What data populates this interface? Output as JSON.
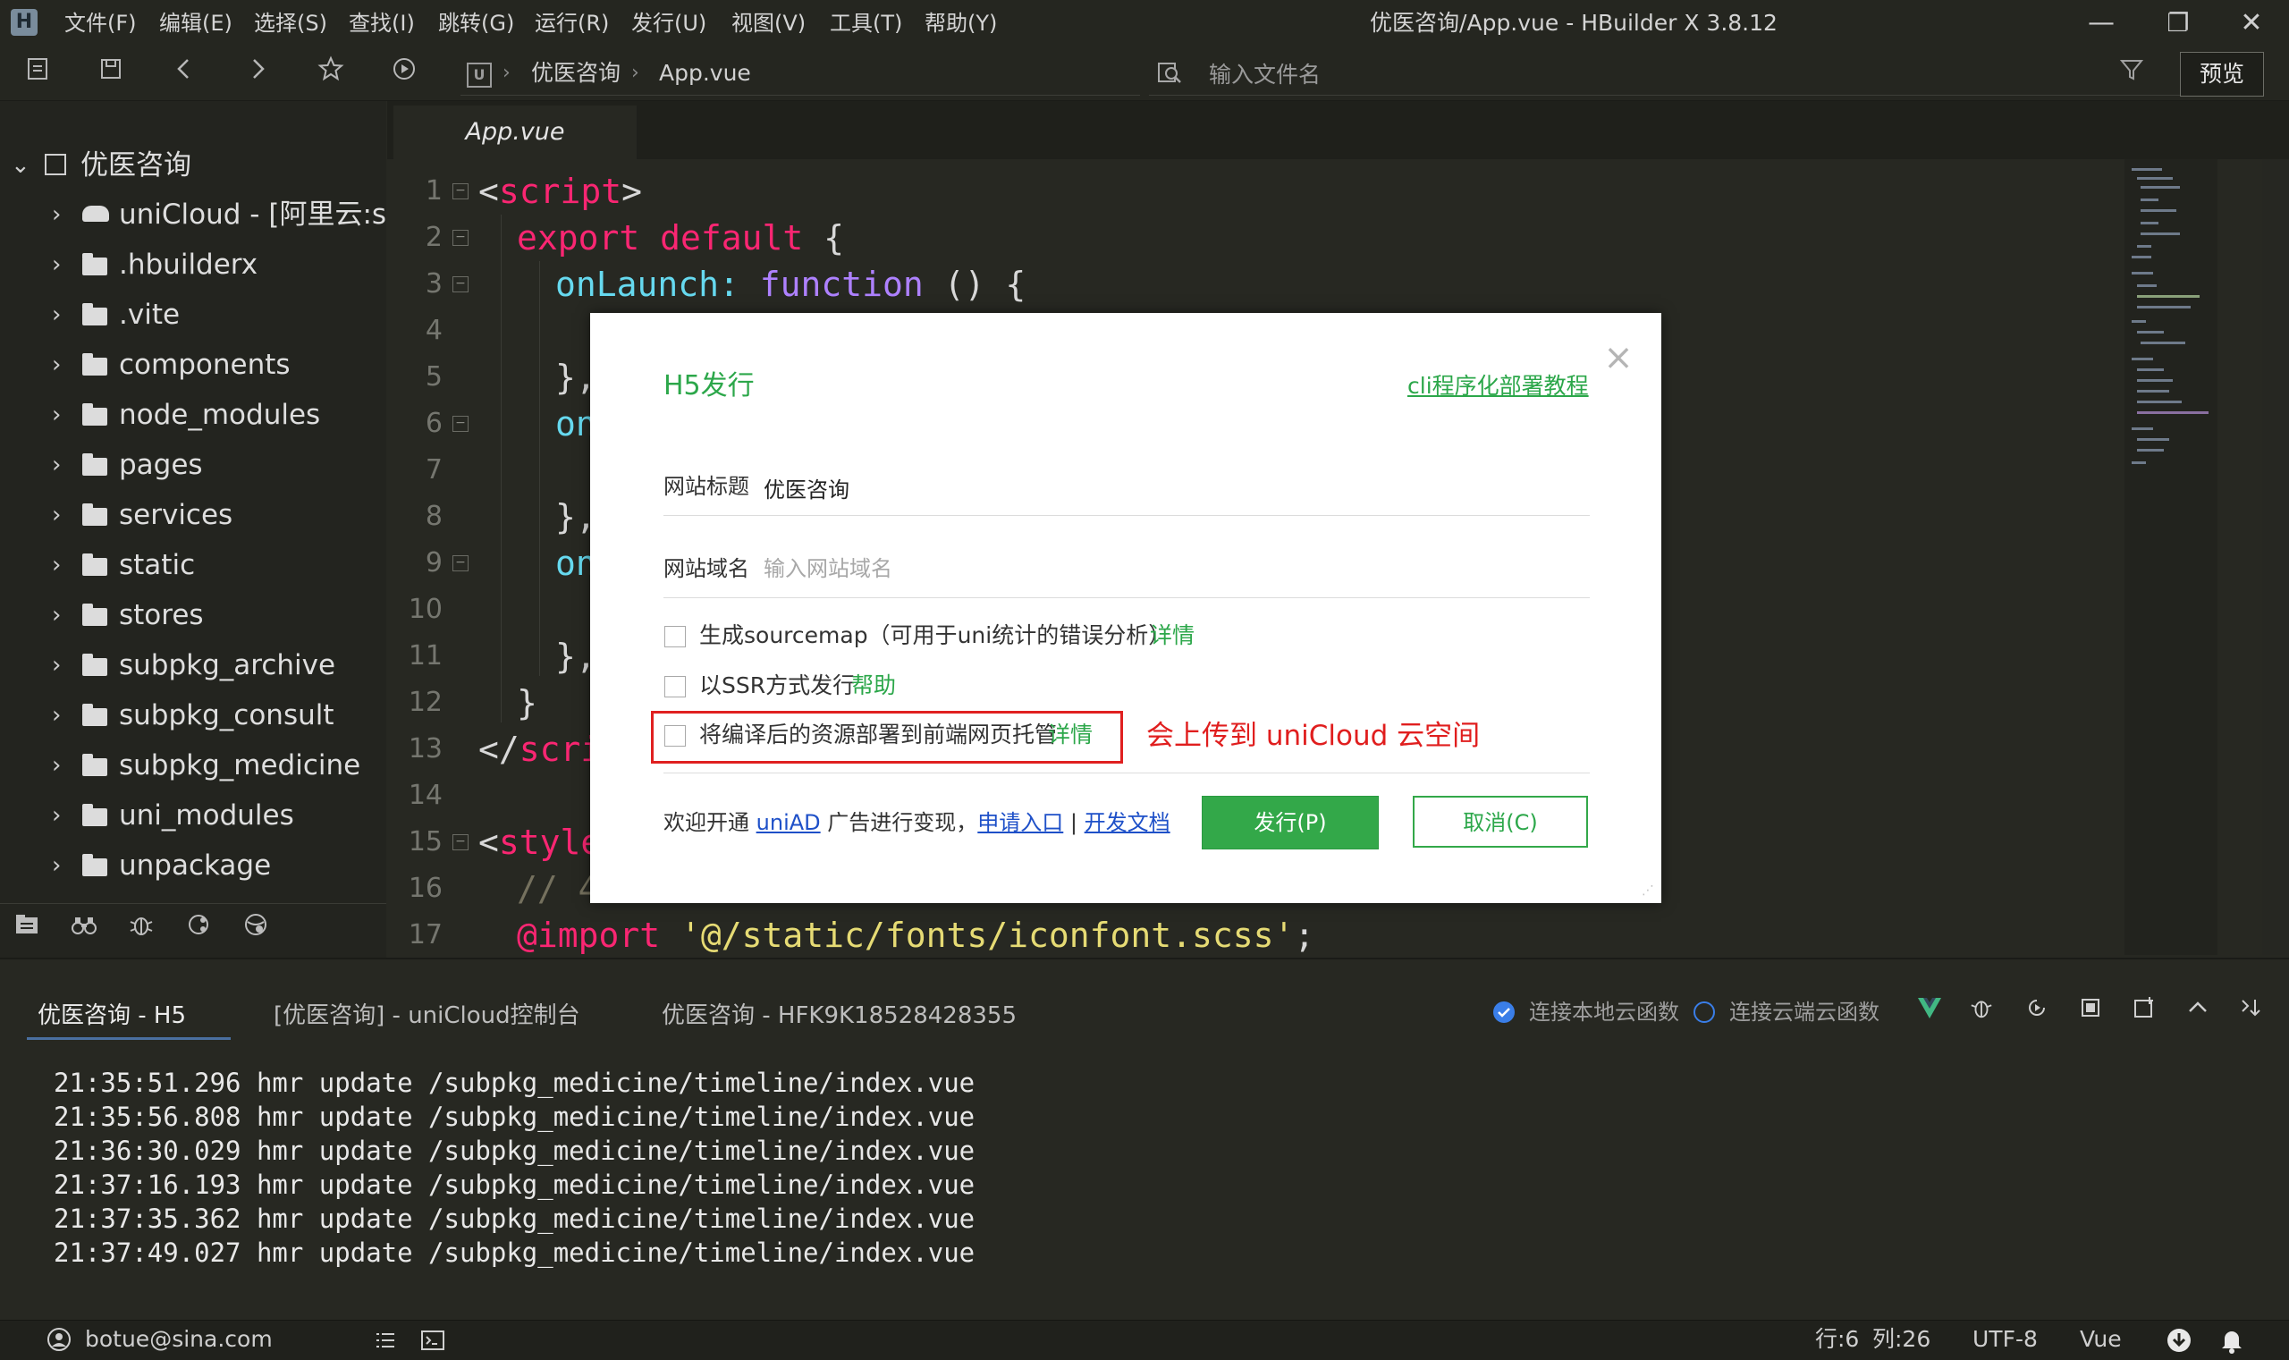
{
  "window": {
    "title": "优医咨询/App.vue - HBuilder X 3.8.12",
    "logo_letter": "H",
    "menu": [
      "文件(F)",
      "编辑(E)",
      "选择(S)",
      "查找(I)",
      "跳转(G)",
      "运行(R)",
      "发行(U)",
      "视图(V)",
      "工具(T)",
      "帮助(Y)"
    ],
    "minimize": "—",
    "restore": "❐",
    "close": "✕"
  },
  "toolbar": {
    "project_badge": "U",
    "breadcrumb": [
      "优医咨询",
      "App.vue"
    ],
    "breadcrumb_sep": "›",
    "file_search_placeholder": "输入文件名",
    "preview_label": "预览"
  },
  "sidebar": {
    "root": "优医咨询",
    "items": [
      "uniCloud - [阿里云:s",
      ".hbuilderx",
      ".vite",
      "components",
      "node_modules",
      "pages",
      "services",
      "static",
      "stores",
      "subpkg_archive",
      "subpkg_consult",
      "subpkg_medicine",
      "uni_modules",
      "unpackage"
    ]
  },
  "editor": {
    "tab": "App.vue",
    "line_numbers": [
      "1",
      "2",
      "3",
      "4",
      "5",
      "6",
      "7",
      "8",
      "9",
      "10",
      "11",
      "12",
      "13",
      "14",
      "15",
      "16",
      "17"
    ],
    "code": {
      "l1_open": "<",
      "l1_tag": "script",
      "l1_close": ">",
      "l2_kw": "export default",
      "l2_brace": " {",
      "l3_prop": "onLaunch:",
      "l3_kw": " function",
      "l3_rest": " () {",
      "l5": "},",
      "l6": "on",
      "l8": "},",
      "l9": "on",
      "l11": "},",
      "l12": "}",
      "l13_open": "</",
      "l13_tag": "scri",
      "l15_open": "<",
      "l15_tag": "style",
      "l16": "// 4",
      "l17_at": "@import",
      "l17_str": " '@/static/fonts/iconfont.scss'",
      "l17_end": ";"
    }
  },
  "console": {
    "tabs": [
      "优医咨询 - H5",
      "[优医咨询] - uniCloud控制台",
      "优医咨询 - HFK9K18528428355"
    ],
    "radio_local": "连接本地云函数",
    "radio_cloud": "连接云端云函数",
    "log": [
      "21:35:51.296 hmr update /subpkg_medicine/timeline/index.vue",
      "21:35:56.808 hmr update /subpkg_medicine/timeline/index.vue",
      "21:36:30.029 hmr update /subpkg_medicine/timeline/index.vue",
      "21:37:16.193 hmr update /subpkg_medicine/timeline/index.vue",
      "21:37:35.362 hmr update /subpkg_medicine/timeline/index.vue",
      "21:37:49.027 hmr update /subpkg_medicine/timeline/index.vue"
    ]
  },
  "status": {
    "user": "botue@sina.com",
    "position_line": "行:6",
    "position_col": "列:26",
    "encoding": "UTF-8",
    "language": "Vue"
  },
  "dialog": {
    "title": "H5发行",
    "cli_link": "cli程序化部署教程",
    "site_title_label": "网站标题",
    "site_title_value": "优医咨询",
    "site_domain_label": "网站域名",
    "site_domain_placeholder": "输入网站域名",
    "opt_sourcemap": "生成sourcemap（可用于uni统计的错误分析）",
    "opt_sourcemap_link": "详情",
    "opt_ssr": "以SSR方式发行",
    "opt_ssr_link": "帮助",
    "opt_deploy": "将编译后的资源部署到前端网页托管",
    "opt_deploy_link": "详情",
    "annotation": "会上传到 uniCloud 云空间",
    "footer_prefix": "欢迎开通",
    "footer_uniad": "uniAD",
    "footer_mid": "广告进行变现，",
    "footer_apply": "申请入口",
    "footer_bar": "|",
    "footer_docs": "开发文档",
    "publish_btn": "发行(P)",
    "cancel_btn": "取消(C)"
  },
  "colors": {
    "accent_green": "#2ca74a",
    "link_blue": "#1e50c8",
    "annotation_red": "#e01e1e",
    "keyword": "#f92672",
    "tag": "#f92672",
    "property": "#66d9ef",
    "string": "#e6db74",
    "function_kw": "#ae81ff"
  }
}
